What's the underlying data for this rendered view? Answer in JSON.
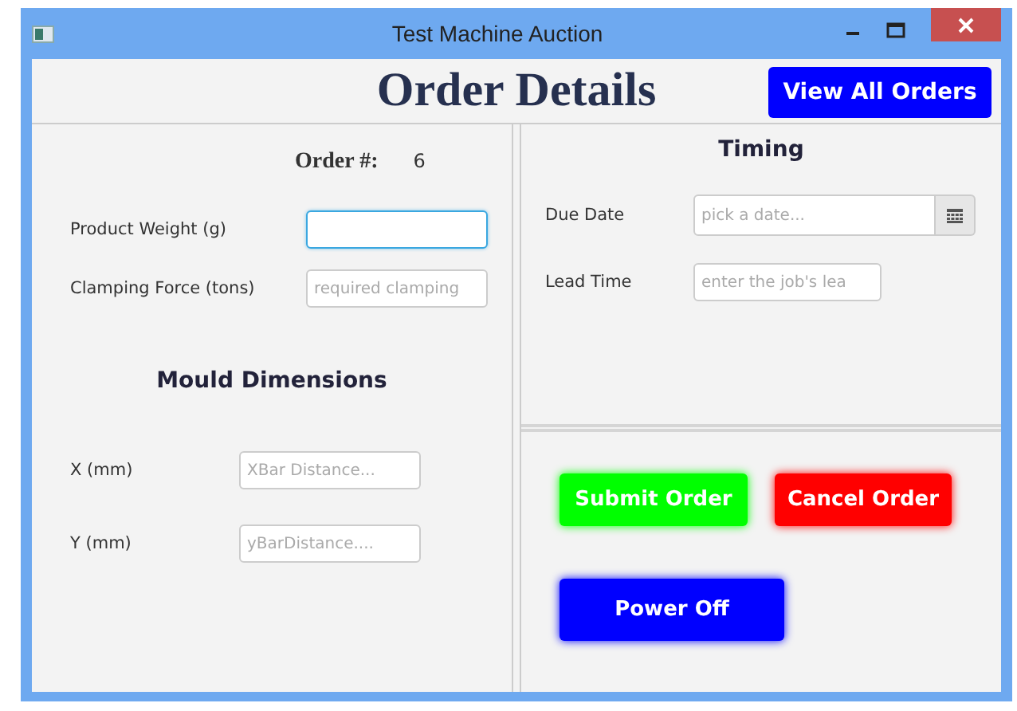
{
  "window": {
    "title": "Test Machine Auction"
  },
  "header": {
    "title": "Order Details",
    "button": "View All Orders"
  },
  "order": {
    "label": "Order #:",
    "value": "6"
  },
  "product_fields": [
    {
      "label": "Product Weight (g)",
      "focused": true
    },
    {
      "label": "Clamping Force (tons)",
      "placeholder": "required clamping",
      "focused": false
    }
  ],
  "mould": {
    "title": "Mould Dimensions",
    "fields": [
      {
        "label": "X (mm)",
        "placeholder": "XBar Distance..."
      },
      {
        "label": "Y (mm)",
        "placeholder": "yBarDistance...."
      }
    ]
  },
  "timing": {
    "title": "Timing",
    "due_date": {
      "label": "Due Date",
      "placeholder": "pick a date..."
    },
    "lead_time": {
      "label": "Lead Time",
      "placeholder": "enter the job's lea"
    }
  },
  "actions": [
    {
      "label": "Submit Order",
      "color": "#00ff00"
    },
    {
      "label": "Cancel Order",
      "color": "#ff0000"
    },
    {
      "label": "Power Off",
      "color": "#0000ff"
    }
  ]
}
